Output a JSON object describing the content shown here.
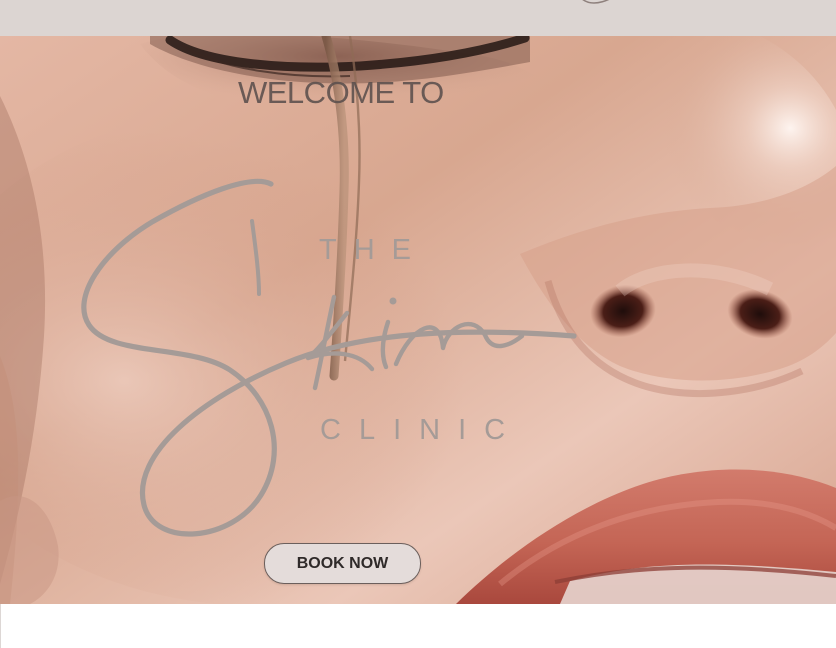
{
  "header": {
    "background_color": "#dcd5d2",
    "decoration": "script-swoosh"
  },
  "hero": {
    "heading": "WELCOME TO",
    "logo": {
      "word_top": "THE",
      "script_word": "Skin",
      "word_bottom": "CLINIC",
      "color": "#a59b97"
    },
    "image": {
      "subject": "close-up face photo",
      "tone": "#d9aa95"
    },
    "cta_label": "BOOK NOW",
    "cta_color": "#e4dcda"
  },
  "icons": {
    "logo_script": "script-logo-icon",
    "topbar_swoosh": "swoosh-icon"
  },
  "colors": {
    "heading": "#5b4f4d",
    "accent_lip": "#c86d60",
    "page_background": "#ffffff"
  }
}
